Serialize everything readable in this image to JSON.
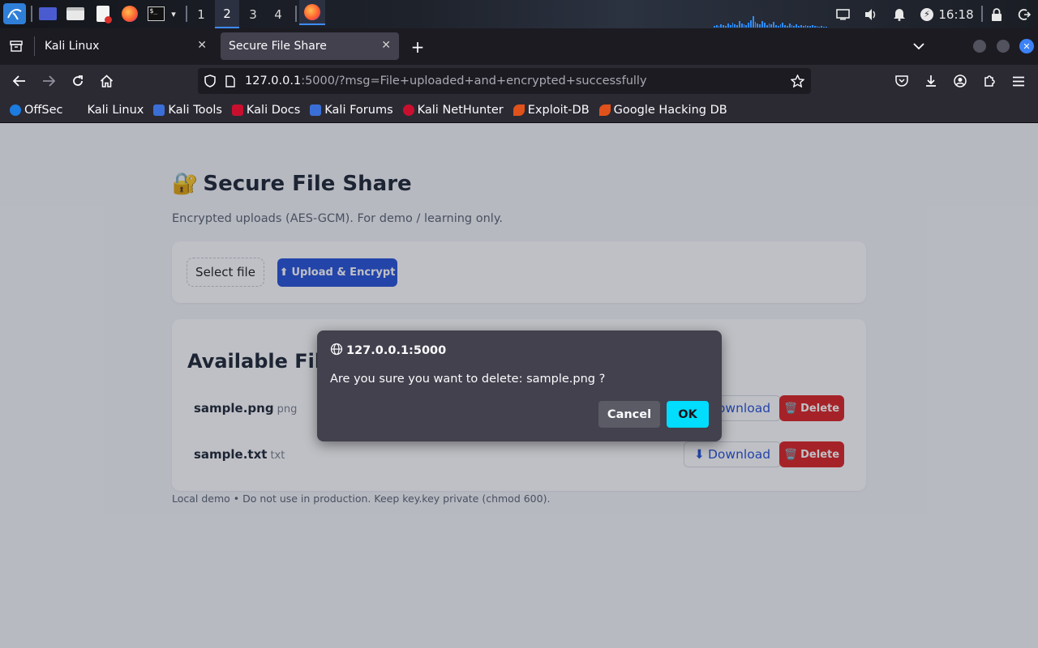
{
  "taskbar": {
    "workspaces": [
      "1",
      "2",
      "3",
      "4"
    ],
    "active_workspace": "2",
    "clock": "16:18",
    "icons": [
      "kali-menu-icon",
      "desktop-icon",
      "files-icon",
      "text-editor-icon",
      "firefox-icon",
      "terminal-icon",
      "dropdown-chevron-icon"
    ],
    "tray_icons": [
      "display-icon",
      "volume-icon",
      "notification-bell-icon",
      "power-icon",
      "lock-icon",
      "logout-icon"
    ]
  },
  "browser": {
    "tabs": [
      {
        "label": "Kali Linux",
        "active": false
      },
      {
        "label": "Secure File Share",
        "active": true
      }
    ],
    "url_host": "127.0.0.1",
    "url_rest": ":5000/?msg=File+uploaded+and+encrypted+successfully",
    "bookmarks": [
      {
        "label": "OffSec",
        "color": "#1c7ce0"
      },
      {
        "label": "Kali Linux",
        "color": "#2b2a33"
      },
      {
        "label": "Kali Tools",
        "color": "#3b6fd8"
      },
      {
        "label": "Kali Docs",
        "color": "#c8102e"
      },
      {
        "label": "Kali Forums",
        "color": "#3b6fd8"
      },
      {
        "label": "Kali NetHunter",
        "color": "#c8102e"
      },
      {
        "label": "Exploit-DB",
        "color": "#e0521b"
      },
      {
        "label": "Google Hacking DB",
        "color": "#e0521b"
      }
    ]
  },
  "page": {
    "title_icon": "🔐",
    "title": "Secure File Share",
    "subtitle": "Encrypted uploads (AES-GCM). For demo / learning only.",
    "select_file_label": "Select file",
    "upload_icon": "⬆",
    "upload_label": "Upload & Encrypt",
    "files_heading": "Available Files",
    "files": [
      {
        "name": "sample.png",
        "ext": "png",
        "download_label": "Download",
        "delete_label": "Delete"
      },
      {
        "name": "sample.txt",
        "ext": "txt",
        "download_label": "Download",
        "delete_label": "Delete"
      }
    ],
    "download_icon": "⬇",
    "delete_icon": "🗑️",
    "footer": "Local demo • Do not use in production. Keep key.key private (chmod 600)."
  },
  "dialog": {
    "origin": "127.0.0.1:5000",
    "message": "Are you sure you want to delete: sample.png ?",
    "cancel_label": "Cancel",
    "ok_label": "OK"
  },
  "colors": {
    "accent_blue": "#2854d8",
    "danger_red": "#dc2626",
    "dialog_ok": "#00ddff"
  }
}
